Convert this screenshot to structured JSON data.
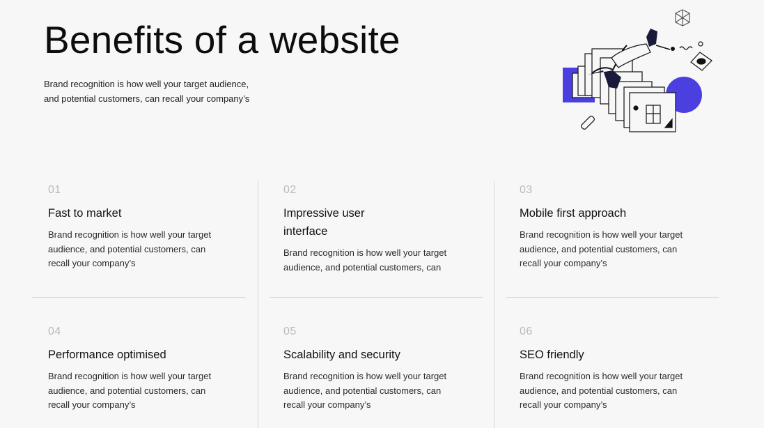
{
  "hero": {
    "title": "Benefits of a website",
    "intro": "Brand recognition is how well your target audience, and potential customers, can recall your company’s"
  },
  "colors": {
    "accent": "#4B3FE0",
    "ink": "#111111",
    "muted": "#b9b9b9",
    "divider": "#d6d6d6"
  },
  "illustration": {
    "icon": "person-with-screens-illustration"
  },
  "benefits": [
    {
      "number": "01",
      "title": "Fast to market",
      "description": "Brand recognition is how well your target audience, and potential customers, can recall your company’s"
    },
    {
      "number": "02",
      "title": "Impressive user interface",
      "description": "Brand recognition is how well your target audience, and potential customers, can"
    },
    {
      "number": "03",
      "title": "Mobile first approach",
      "description": "Brand recognition is how well your target audience, and potential customers, can recall your company’s"
    },
    {
      "number": "04",
      "title": "Performance optimised",
      "description": "Brand recognition is how well your target audience, and potential customers, can recall your company’s"
    },
    {
      "number": "05",
      "title": "Scalability and security",
      "description": "Brand recognition is how well your target audience, and potential customers, can recall your company’s"
    },
    {
      "number": "06",
      "title": "SEO friendly",
      "description": "Brand recognition is how well your target audience, and potential customers, can recall your company’s"
    }
  ]
}
